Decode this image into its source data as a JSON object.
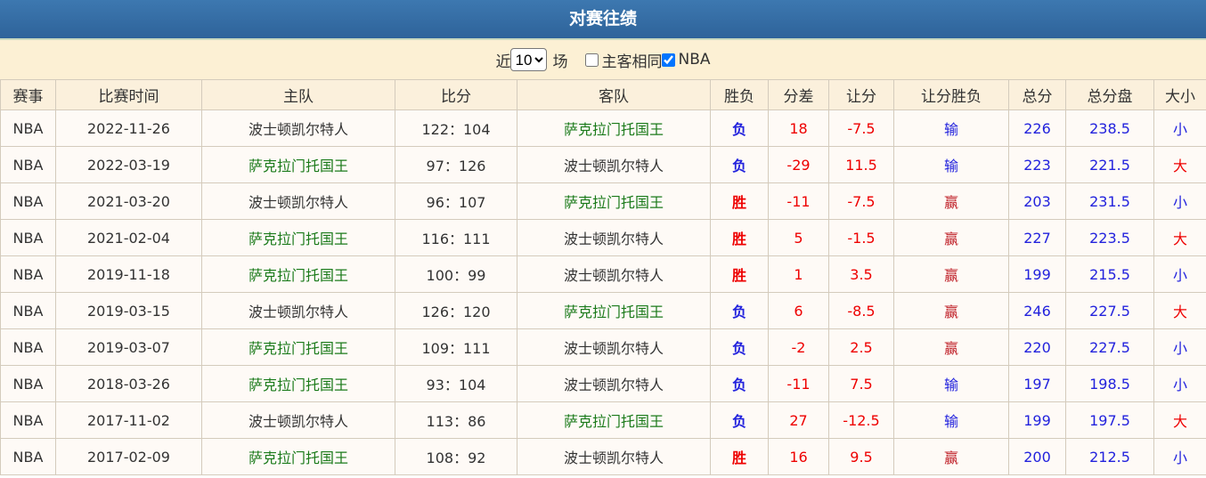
{
  "title": "对赛往绩",
  "filter": {
    "prefix": "近",
    "count": "10",
    "suffix": "场",
    "same_home_label": "主客相同",
    "same_home_checked": false,
    "league_label": "NBA",
    "league_checked": true
  },
  "headers": [
    "赛事",
    "比赛时间",
    "主队",
    "比分",
    "客队",
    "胜负",
    "分差",
    "让分",
    "让分胜负",
    "总分",
    "总分盘",
    "大小"
  ],
  "rows": [
    [
      "NBA",
      "2022-11-26",
      "波士顿凯尔特人",
      "122：104",
      "萨克拉门托国王",
      "负",
      "18",
      "-7.5",
      "输",
      "226",
      "238.5",
      "小"
    ],
    [
      "NBA",
      "2022-03-19",
      "萨克拉门托国王",
      "97：126",
      "波士顿凯尔特人",
      "负",
      "-29",
      "11.5",
      "输",
      "223",
      "221.5",
      "大"
    ],
    [
      "NBA",
      "2021-03-20",
      "波士顿凯尔特人",
      "96：107",
      "萨克拉门托国王",
      "胜",
      "-11",
      "-7.5",
      "赢",
      "203",
      "231.5",
      "小"
    ],
    [
      "NBA",
      "2021-02-04",
      "萨克拉门托国王",
      "116：111",
      "波士顿凯尔特人",
      "胜",
      "5",
      "-1.5",
      "赢",
      "227",
      "223.5",
      "大"
    ],
    [
      "NBA",
      "2019-11-18",
      "萨克拉门托国王",
      "100：99",
      "波士顿凯尔特人",
      "胜",
      "1",
      "3.5",
      "赢",
      "199",
      "215.5",
      "小"
    ],
    [
      "NBA",
      "2019-03-15",
      "波士顿凯尔特人",
      "126：120",
      "萨克拉门托国王",
      "负",
      "6",
      "-8.5",
      "赢",
      "246",
      "227.5",
      "大"
    ],
    [
      "NBA",
      "2019-03-07",
      "萨克拉门托国王",
      "109：111",
      "波士顿凯尔特人",
      "负",
      "-2",
      "2.5",
      "赢",
      "220",
      "227.5",
      "小"
    ],
    [
      "NBA",
      "2018-03-26",
      "萨克拉门托国王",
      "93：104",
      "波士顿凯尔特人",
      "负",
      "-11",
      "7.5",
      "输",
      "197",
      "198.5",
      "小"
    ],
    [
      "NBA",
      "2017-11-02",
      "波士顿凯尔特人",
      "113：86",
      "萨克拉门托国王",
      "负",
      "27",
      "-12.5",
      "输",
      "199",
      "197.5",
      "大"
    ],
    [
      "NBA",
      "2017-02-09",
      "萨克拉门托国王",
      "108：92",
      "波士顿凯尔特人",
      "胜",
      "16",
      "9.5",
      "赢",
      "200",
      "212.5",
      "小"
    ]
  ],
  "highlight_team": "萨克拉门托国王"
}
